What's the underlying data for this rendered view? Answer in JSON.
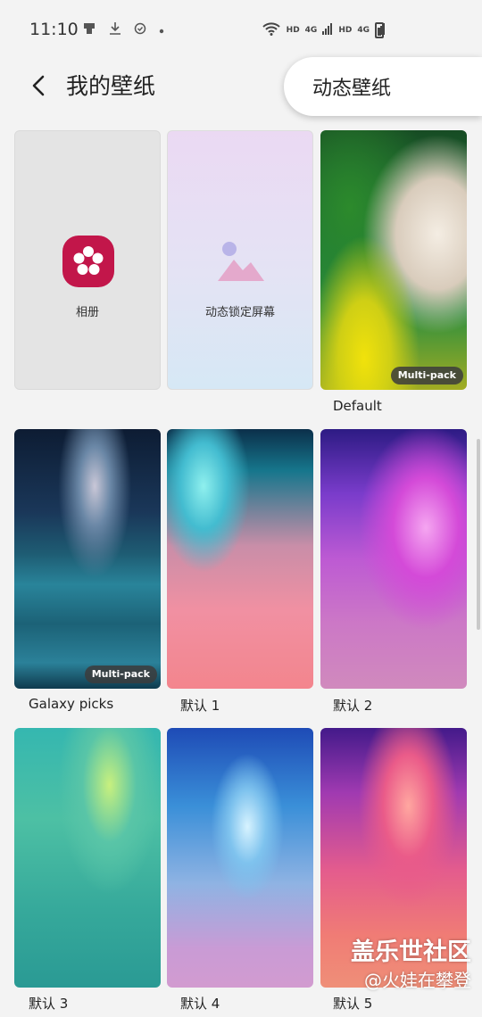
{
  "status_bar": {
    "time": "11:10",
    "left_icons": [
      "usb-icon",
      "download-icon",
      "sync-icon",
      "dot-icon"
    ],
    "net1": "HD",
    "sig1": "4G",
    "net2": "HD",
    "sig2": "4G"
  },
  "header": {
    "title": "我的壁纸",
    "live_wallpaper_button": "动态壁纸"
  },
  "tiles": {
    "gallery_label": "相册",
    "live_lock_label": "动态锁定屏幕",
    "default_caption": "Default",
    "default_badge": "Multi-pack",
    "galaxy_caption": "Galaxy picks",
    "galaxy_badge": "Multi-pack",
    "d1_caption": "默认 1",
    "d2_caption": "默认 2",
    "d3_caption": "默认 3",
    "d4_caption": "默认 4",
    "d5_caption": "默认 5"
  },
  "watermark": {
    "line1": "盖乐世社区",
    "line2": "@火娃在攀登"
  },
  "colors": {
    "gallery_icon": "#c2164a",
    "background": "#f3f3f3"
  }
}
